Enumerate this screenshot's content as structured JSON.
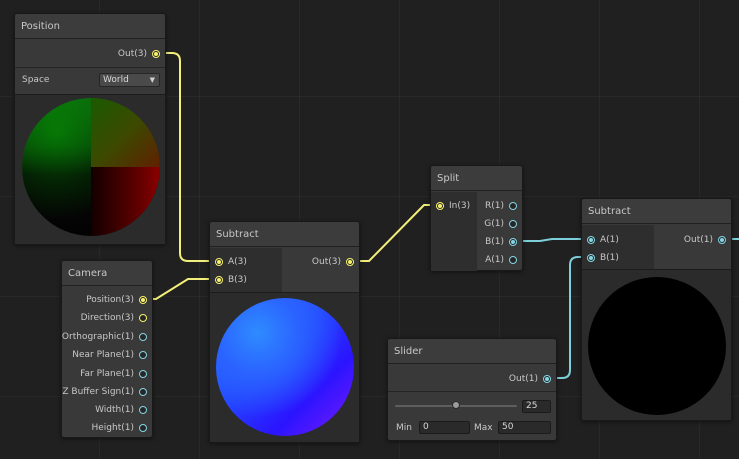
{
  "nodes": {
    "position": {
      "title": "Position",
      "output": "Out(3)",
      "space_label": "Space",
      "space_value": "World"
    },
    "camera": {
      "title": "Camera",
      "outputs": [
        "Position(3)",
        "Direction(3)",
        "Orthographic(1)",
        "Near Plane(1)",
        "Far Plane(1)",
        "Z Buffer Sign(1)",
        "Width(1)",
        "Height(1)"
      ]
    },
    "subtract_1": {
      "title": "Subtract",
      "inputs": [
        "A(3)",
        "B(3)"
      ],
      "output": "Out(3)"
    },
    "split": {
      "title": "Split",
      "input": "In(3)",
      "outputs": [
        "R(1)",
        "G(1)",
        "B(1)",
        "A(1)"
      ]
    },
    "subtract_2": {
      "title": "Subtract",
      "inputs": [
        "A(1)",
        "B(1)"
      ],
      "output": "Out(1)"
    },
    "slider": {
      "title": "Slider",
      "output": "Out(1)",
      "value": "25",
      "min_label": "Min",
      "min_value": "0",
      "max_label": "Max",
      "max_value": "50"
    }
  },
  "port_colors": {
    "vector3": "#f7f26d",
    "vector1": "#83d5e3"
  },
  "icons": [
    "dropdown-arrow-icon"
  ]
}
